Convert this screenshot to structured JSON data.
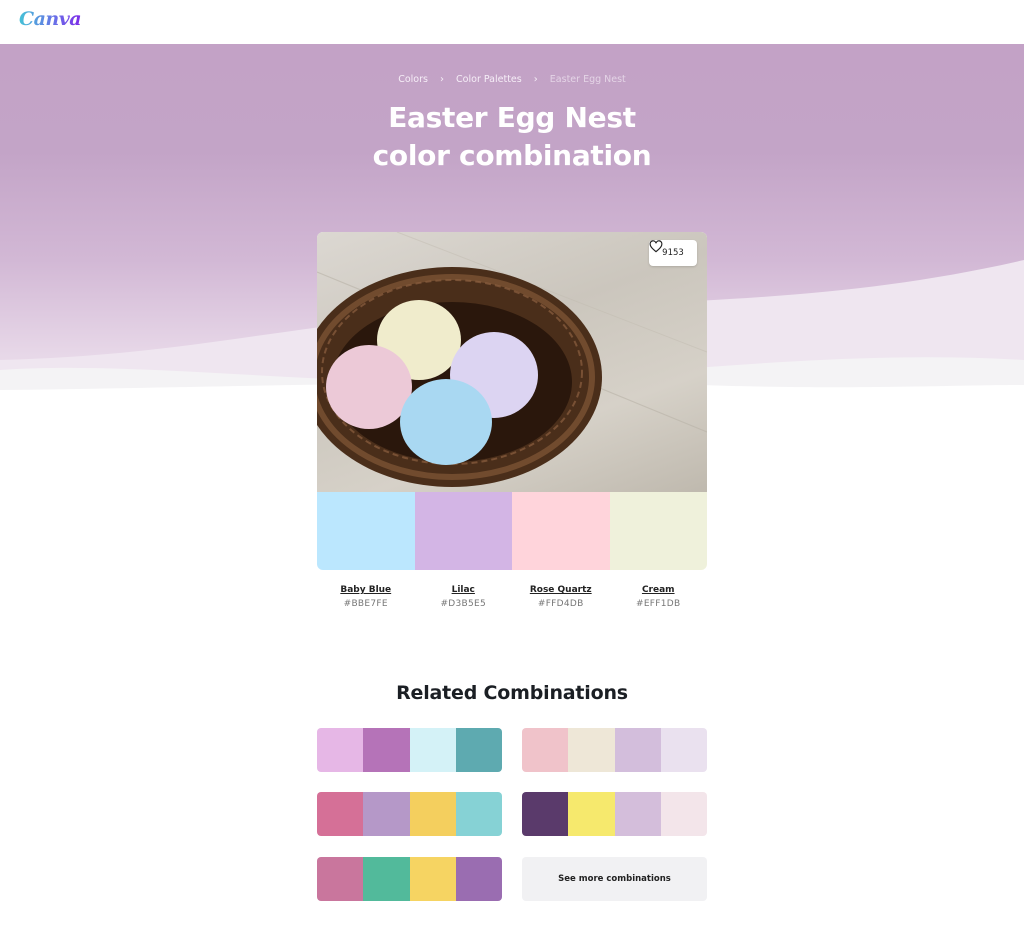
{
  "header": {
    "logo": "Canva"
  },
  "breadcrumb": [
    {
      "label": "Colors"
    },
    {
      "label": "Color Palettes"
    },
    {
      "label": "Easter Egg Nest"
    }
  ],
  "breadcrumb_separator": "›",
  "page": {
    "title_line1": "Easter Egg Nest",
    "title_line2": "color combination",
    "likes": "9153",
    "like_icon": "heart-icon"
  },
  "palette": [
    {
      "name": "Baby Blue",
      "hex": "#BBE7FE"
    },
    {
      "name": "Lilac",
      "hex": "#D3B5E5"
    },
    {
      "name": "Rose Quartz",
      "hex": "#FFD4DB"
    },
    {
      "name": "Cream",
      "hex": "#EFF1DB"
    }
  ],
  "related": {
    "title": "Related Combinations",
    "combinations": [
      [
        "#E6B7E6",
        "#B573B8",
        "#D4F2F7",
        "#5EAAB0"
      ],
      [
        "#F0C3CA",
        "#EEE7D7",
        "#D3BEDC",
        "#EAE1EF"
      ],
      [
        "#D57097",
        "#B598C8",
        "#F4CF5E",
        "#86D2D5"
      ],
      [
        "#5A3A6B",
        "#F6E96D",
        "#D4BEDB",
        "#F3E5EA"
      ],
      [
        "#C9769D",
        "#52BA9B",
        "#F6D462",
        "#9A6DB1"
      ]
    ],
    "see_more_label": "See more combinations"
  }
}
